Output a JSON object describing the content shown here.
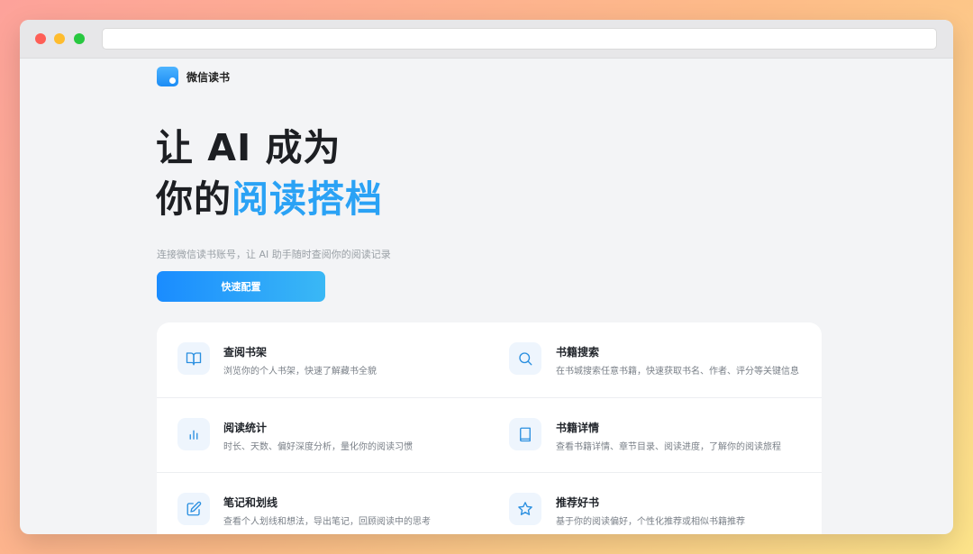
{
  "brand": {
    "name": "微信读书"
  },
  "hero": {
    "line1": "让 AI 成为",
    "line2_prefix": "你的",
    "line2_accent": "阅读搭档",
    "subtitle": "连接微信读书账号，让 AI 助手随时查阅你的阅读记录"
  },
  "cta": {
    "label": "快速配置"
  },
  "features": [
    {
      "icon": "book-open-icon",
      "title": "查阅书架",
      "desc": "浏览你的个人书架，快速了解藏书全貌"
    },
    {
      "icon": "search-icon",
      "title": "书籍搜索",
      "desc": "在书城搜索任意书籍，快速获取书名、作者、评分等关键信息"
    },
    {
      "icon": "bar-chart-icon",
      "title": "阅读统计",
      "desc": "时长、天数、偏好深度分析，量化你的阅读习惯"
    },
    {
      "icon": "book-icon",
      "title": "书籍详情",
      "desc": "查看书籍详情、章节目录、阅读进度，了解你的阅读旅程"
    },
    {
      "icon": "edit-icon",
      "title": "笔记和划线",
      "desc": "查看个人划线和想法，导出笔记，回顾阅读中的思考"
    },
    {
      "icon": "star-icon",
      "title": "推荐好书",
      "desc": "基于你的阅读偏好，个性化推荐或相似书籍推荐"
    }
  ],
  "colors": {
    "accent": "#2aa2f5",
    "icon_bg": "#eef5fd",
    "icon_stroke": "#2a8fe0"
  }
}
